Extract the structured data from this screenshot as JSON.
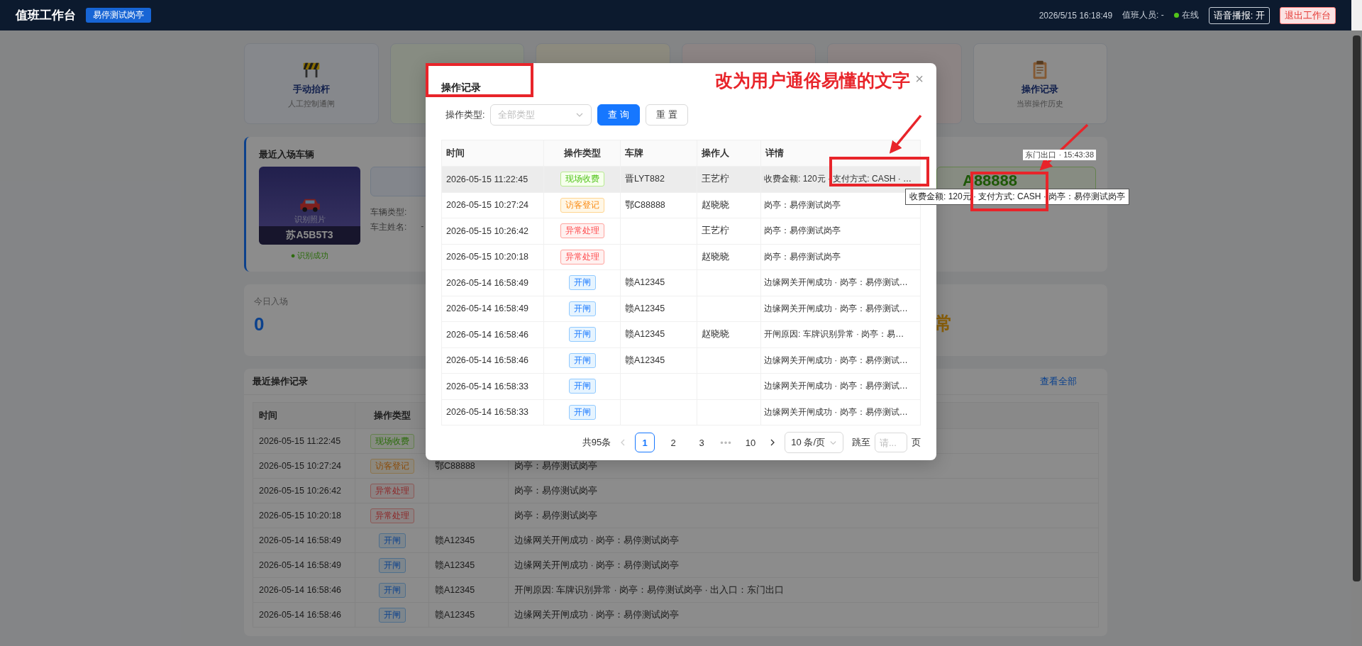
{
  "header": {
    "title": "值班工作台",
    "station_tag": "易停测试岗亭",
    "datetime": "2026/5/15 16:18:49",
    "staff": "值班人员: -",
    "status": {
      "label": "在线",
      "online": true
    },
    "voice_button": "语音播报: 开",
    "exit_button": "退出工作台"
  },
  "quick_actions": [
    {
      "kind": "lift",
      "title": "手动抬杆",
      "subtitle": "人工控制通闸"
    },
    {
      "kind": "green"
    },
    {
      "kind": "yellow"
    },
    {
      "kind": "red"
    },
    {
      "kind": "red"
    },
    {
      "kind": "log",
      "title": "操作记录",
      "subtitle": "当班操作历史"
    }
  ],
  "recent_vehicle": {
    "title": "最近入场车辆",
    "photo_caption": "识别照片",
    "plate": "苏A5B5T3",
    "status": "● 识别成功",
    "fields": [
      {
        "label": "车辆类型:"
      },
      {
        "label": "车主姓名:",
        "value": "-"
      }
    ],
    "exit_info": "东门出口 · 15:43:38",
    "exit_plate": "A88888"
  },
  "stats": [
    {
      "label": "今日入场",
      "value": "0",
      "kind": "count"
    },
    {
      "value": "常",
      "kind": "status"
    }
  ],
  "recent_ops": {
    "title": "最近操作记录",
    "link": "查看全部",
    "columns": [
      "时间",
      "操作类型"
    ],
    "rows": [
      {
        "time": "2026-05-15 11:22:45",
        "type": "现场收费",
        "kind": "fee"
      },
      {
        "time": "2026-05-15 10:27:24",
        "type": "访客登记",
        "kind": "visitor",
        "plate": "鄂C88888",
        "detail": "岗亭：易停测试岗亭"
      },
      {
        "time": "2026-05-15 10:26:42",
        "type": "异常处理",
        "kind": "exception",
        "detail": "岗亭：易停测试岗亭"
      },
      {
        "time": "2026-05-15 10:20:18",
        "type": "异常处理",
        "kind": "exception",
        "detail": "岗亭：易停测试岗亭"
      },
      {
        "time": "2026-05-14 16:58:49",
        "type": "开闸",
        "kind": "open",
        "plate": "赣A12345",
        "detail": "边缘网关开闸成功 · 岗亭：易停测试岗亭"
      },
      {
        "time": "2026-05-14 16:58:49",
        "type": "开闸",
        "kind": "open",
        "plate": "赣A12345",
        "detail": "边缘网关开闸成功 · 岗亭：易停测试岗亭"
      },
      {
        "time": "2026-05-14 16:58:46",
        "type": "开闸",
        "kind": "open",
        "plate": "赣A12345",
        "detail": "开闸原因: 车牌识别异常 · 岗亭：易停测试岗亭 · 出入口：东门出口"
      },
      {
        "time": "2026-05-14 16:58:46",
        "type": "开闸",
        "kind": "open",
        "plate": "赣A12345",
        "detail": "边缘网关开闸成功 · 岗亭：易停测试岗亭"
      }
    ]
  },
  "modal": {
    "title": "操作记录",
    "close": "×",
    "filter": {
      "label": "操作类型:",
      "placeholder": "全部类型",
      "search_button": "查 询",
      "reset_button": "重 置"
    },
    "columns": [
      "时间",
      "操作类型",
      "车牌",
      "操作人",
      "详情"
    ],
    "rows": [
      {
        "time": "2026-05-15 11:22:45",
        "type": "现场收费",
        "kind": "fee",
        "plate": "晋LYT882",
        "operator": "王艺柠",
        "detail": "收费金额: 120元 · 支付方式: CASH · …",
        "hovered": true
      },
      {
        "time": "2026-05-15 10:27:24",
        "type": "访客登记",
        "kind": "visitor",
        "plate": "鄂C88888",
        "operator": "赵晓晓",
        "detail": "岗亭：易停测试岗亭",
        "hovered": false
      },
      {
        "time": "2026-05-15 10:26:42",
        "type": "异常处理",
        "kind": "exception",
        "operator": "王艺柠",
        "detail": "岗亭：易停测试岗亭",
        "hovered": false
      },
      {
        "time": "2026-05-15 10:20:18",
        "type": "异常处理",
        "kind": "exception",
        "operator": "赵晓晓",
        "detail": "岗亭：易停测试岗亭",
        "hovered": false
      },
      {
        "time": "2026-05-14 16:58:49",
        "type": "开闸",
        "kind": "open",
        "plate": "赣A12345",
        "detail": "边缘网关开闸成功 · 岗亭：易停测试…",
        "hovered": false
      },
      {
        "time": "2026-05-14 16:58:49",
        "type": "开闸",
        "kind": "open",
        "plate": "赣A12345",
        "detail": "边缘网关开闸成功 · 岗亭：易停测试…",
        "hovered": false
      },
      {
        "time": "2026-05-14 16:58:46",
        "type": "开闸",
        "kind": "open",
        "plate": "赣A12345",
        "operator": "赵晓晓",
        "detail": "开闸原因: 车牌识别异常 · 岗亭：易…",
        "hovered": false
      },
      {
        "time": "2026-05-14 16:58:46",
        "type": "开闸",
        "kind": "open",
        "plate": "赣A12345",
        "detail": "边缘网关开闸成功 · 岗亭：易停测试…",
        "hovered": false
      },
      {
        "time": "2026-05-14 16:58:33",
        "type": "开闸",
        "kind": "open",
        "detail": "边缘网关开闸成功 · 岗亭：易停测试…",
        "hovered": false
      },
      {
        "time": "2026-05-14 16:58:33",
        "type": "开闸",
        "kind": "open",
        "detail": "边缘网关开闸成功 · 岗亭：易停测试…",
        "hovered": false
      }
    ],
    "pagination": {
      "total": "共95条",
      "pages": [
        {
          "label": "1",
          "kind": "page",
          "selected": true
        },
        {
          "label": "2",
          "kind": "page",
          "selected": false
        },
        {
          "label": "3",
          "kind": "page",
          "selected": false
        },
        {
          "label": "•••",
          "kind": "ellipsis",
          "selected": false
        },
        {
          "label": "10",
          "kind": "page",
          "selected": false
        }
      ],
      "page_size": "10 条/页",
      "jump_label": "跳至",
      "jump_placeholder": "请...",
      "jump_suffix": "页"
    }
  },
  "tooltip": "收费金额: 120元 · 支付方式: CASH · 岗亭：易停测试岗亭",
  "annotation": {
    "note": "改为用户通俗易懂的文字"
  }
}
